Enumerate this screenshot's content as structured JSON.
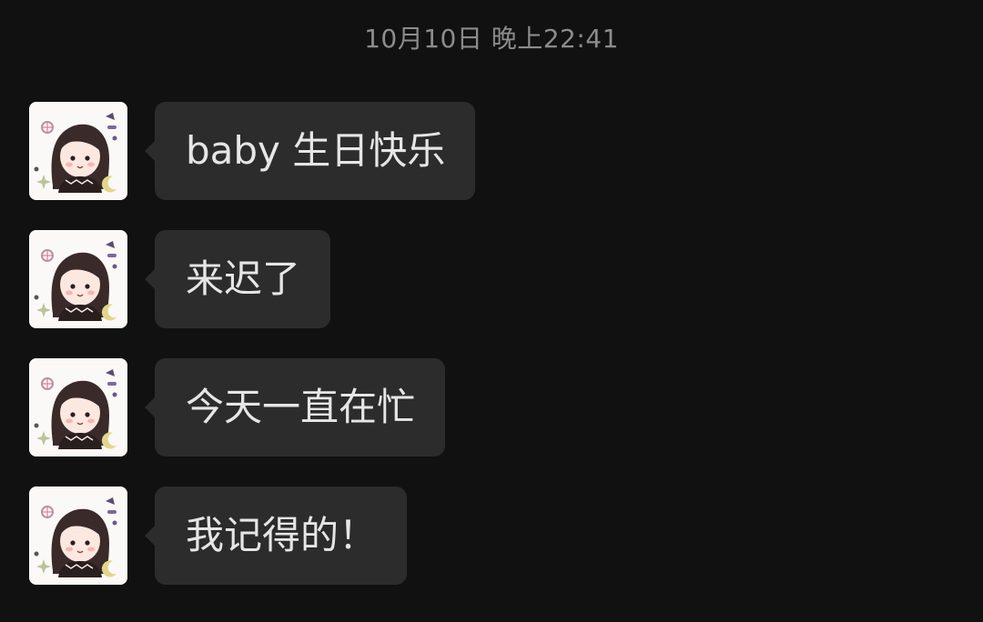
{
  "chat": {
    "timestamp": "10月10日 晚上22:41",
    "messages": [
      {
        "text": "baby 生日快乐",
        "avatar_icon": "cartoon-girl-avatar"
      },
      {
        "text": "来迟了",
        "avatar_icon": "cartoon-girl-avatar"
      },
      {
        "text": "今天一直在忙",
        "avatar_icon": "cartoon-girl-avatar"
      },
      {
        "text": "我记得的！",
        "avatar_icon": "cartoon-girl-avatar"
      }
    ]
  },
  "colors": {
    "background": "#111111",
    "bubble": "#2c2c2c",
    "bubble_text": "#e6e6e6",
    "timestamp_text": "#8c8c8c"
  }
}
